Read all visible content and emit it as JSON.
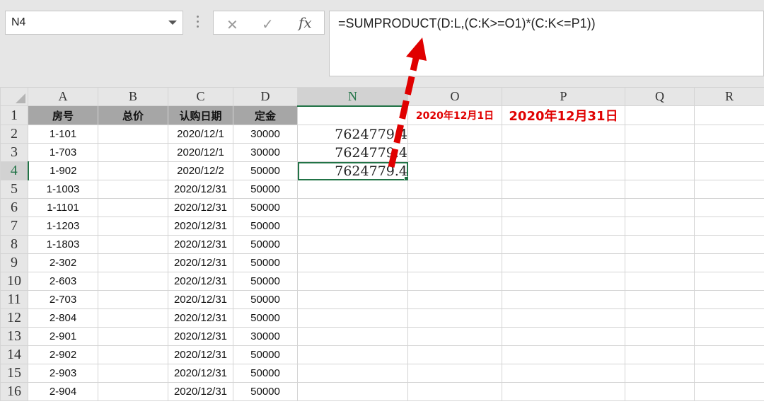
{
  "name_box": {
    "value": "N4"
  },
  "formula_bar": {
    "formula": "=SUMPRODUCT(D:L,(C:K>=O1)*(C:K<=P1))",
    "cancel_icon": "✕",
    "enter_icon": "✓",
    "fx_label": "fx"
  },
  "columns": [
    "A",
    "B",
    "C",
    "D",
    "N",
    "O",
    "P",
    "Q",
    "R"
  ],
  "header_row": {
    "a": "房号",
    "b": "总价",
    "c": "认购日期",
    "d": "定金"
  },
  "criteria": {
    "o1": "2020年12月1日",
    "p1": "2020年12月31日"
  },
  "results": [
    "7624779.4",
    "7624779.4",
    "7624779.4"
  ],
  "rows": [
    {
      "num": "1",
      "a": "",
      "c": "",
      "d": ""
    },
    {
      "num": "2",
      "a": "1-101",
      "c": "2020/12/1",
      "d": "30000"
    },
    {
      "num": "3",
      "a": "1-703",
      "c": "2020/12/1",
      "d": "30000"
    },
    {
      "num": "4",
      "a": "1-902",
      "c": "2020/12/2",
      "d": "50000"
    },
    {
      "num": "5",
      "a": "1-1003",
      "c": "2020/12/31",
      "d": "50000"
    },
    {
      "num": "6",
      "a": "1-1101",
      "c": "2020/12/31",
      "d": "50000"
    },
    {
      "num": "7",
      "a": "1-1203",
      "c": "2020/12/31",
      "d": "50000"
    },
    {
      "num": "8",
      "a": "1-1803",
      "c": "2020/12/31",
      "d": "50000"
    },
    {
      "num": "9",
      "a": "2-302",
      "c": "2020/12/31",
      "d": "50000"
    },
    {
      "num": "10",
      "a": "2-603",
      "c": "2020/12/31",
      "d": "50000"
    },
    {
      "num": "11",
      "a": "2-703",
      "c": "2020/12/31",
      "d": "50000"
    },
    {
      "num": "12",
      "a": "2-804",
      "c": "2020/12/31",
      "d": "50000"
    },
    {
      "num": "13",
      "a": "2-901",
      "c": "2020/12/31",
      "d": "30000"
    },
    {
      "num": "14",
      "a": "2-902",
      "c": "2020/12/31",
      "d": "50000"
    },
    {
      "num": "15",
      "a": "2-903",
      "c": "2020/12/31",
      "d": "50000"
    },
    {
      "num": "16",
      "a": "2-904",
      "c": "2020/12/31",
      "d": "50000"
    }
  ],
  "colors": {
    "accent": "#217346",
    "annotation": "#e00000",
    "header_fill": "#a6a6a6"
  }
}
